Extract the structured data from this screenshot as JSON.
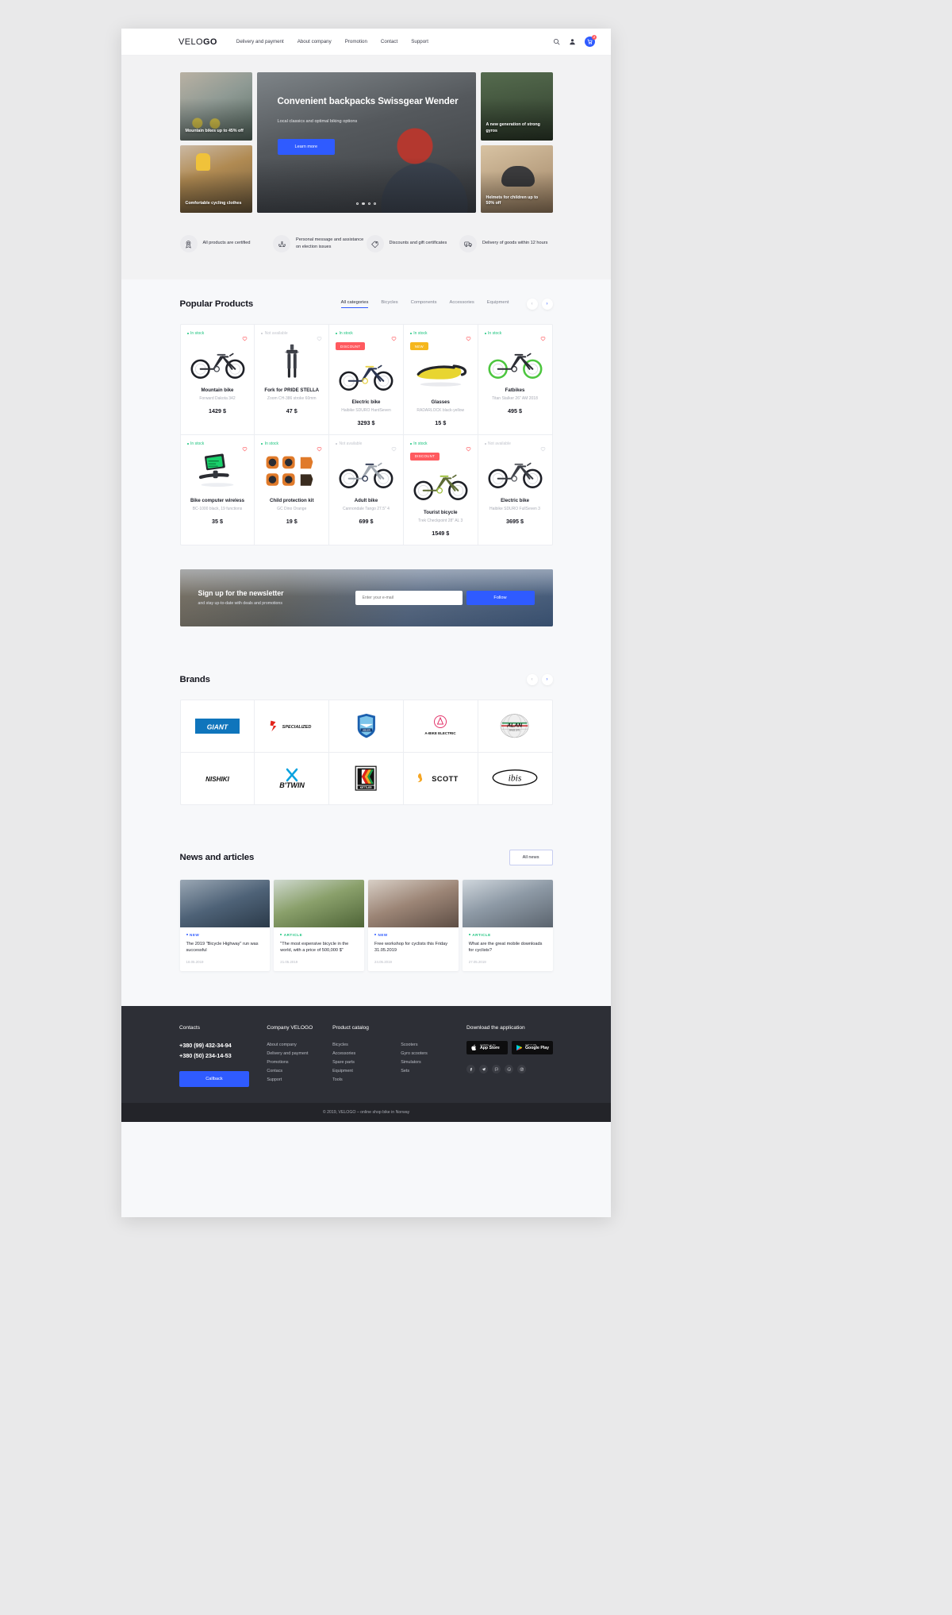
{
  "header": {
    "logo_prefix": "VELO",
    "logo_suffix": "GO",
    "nav": [
      {
        "label": "Delivery and payment"
      },
      {
        "label": "About company"
      },
      {
        "label": "Promotion"
      },
      {
        "label": "Contact"
      },
      {
        "label": "Support"
      }
    ],
    "cart_count": "2"
  },
  "hero": {
    "tiles": [
      {
        "caption": "Mountain bikes up to 45% off"
      },
      {
        "caption": "Comfortable cycling clothes"
      },
      {
        "caption": "A new generation of strong gyros"
      },
      {
        "caption": "Helmets for children up to 50% off"
      }
    ],
    "title": "Convenient backpacks Swissgear Wender",
    "subtitle": "Local classics and optimal biking options",
    "cta": "Learn more",
    "slide_count": 4,
    "active_slide": 2
  },
  "features": [
    {
      "icon": "award-icon",
      "text": "All products are certified"
    },
    {
      "icon": "hands-heart-icon",
      "text": "Personal message and assistance on election issues"
    },
    {
      "icon": "price-tag-icon",
      "text": "Discounts and gift certificates"
    },
    {
      "icon": "delivery-truck-icon",
      "text": "Delivery of goods within 12 hours"
    }
  ],
  "popular": {
    "title": "Popular Products",
    "tabs": [
      {
        "label": "All categories",
        "active": true
      },
      {
        "label": "Bicycles",
        "active": false
      },
      {
        "label": "Components",
        "active": false
      },
      {
        "label": "Accessories",
        "active": false
      },
      {
        "label": "Equipment",
        "active": false
      }
    ],
    "products": [
      {
        "stock": "In stock",
        "available": true,
        "tag": "",
        "name": "Mountain bike",
        "desc": "Forward Dakota 342",
        "price": "1429 $",
        "fav": true,
        "img": "mtb-dark"
      },
      {
        "stock": "Not available",
        "available": false,
        "tag": "",
        "name": "Fork for PRIDE STELLA",
        "desc": "Zoom CH-386 stroke 60mm",
        "price": "47 $",
        "fav": false,
        "img": "fork"
      },
      {
        "stock": "In stock",
        "available": true,
        "tag": "DISCOUNT",
        "name": "Electric bike",
        "desc": "Haibike SDURO HardSeven",
        "price": "3293 $",
        "fav": true,
        "img": "ebike-blue"
      },
      {
        "stock": "In stock",
        "available": true,
        "tag": "NEW",
        "name": "Glasses",
        "desc": "RADARLOCK black-yellow",
        "price": "15 $",
        "fav": true,
        "img": "glasses"
      },
      {
        "stock": "In stock",
        "available": true,
        "tag": "",
        "name": "Fatbikes",
        "desc": "Titan Stalker 26\" AM 2018",
        "price": "495 $",
        "fav": true,
        "img": "fatbike-green"
      },
      {
        "stock": "In stock",
        "available": true,
        "tag": "",
        "name": "Bike computer wireless",
        "desc": "BC-1000 black, 19 functions",
        "price": "35 $",
        "fav": true,
        "img": "computer"
      },
      {
        "stock": "In stock",
        "available": true,
        "tag": "",
        "name": "Child protection kit",
        "desc": "GC Dino Orange",
        "price": "19 $",
        "fav": true,
        "img": "protection"
      },
      {
        "stock": "Not available",
        "available": false,
        "tag": "",
        "name": "Adult bike",
        "desc": "Cannondale Tango 27.5\" 4",
        "price": "699 $",
        "fav": false,
        "img": "adult-bike"
      },
      {
        "stock": "In stock",
        "available": true,
        "tag": "DISCOUNT",
        "name": "Tourist bicycle",
        "desc": "Trek Checkpoint 28\" AL 3",
        "price": "1549 $",
        "fav": true,
        "img": "tourist"
      },
      {
        "stock": "Not available",
        "available": false,
        "tag": "",
        "name": "Electric bike",
        "desc": "Haibike SDURO FullSeven 3",
        "price": "3695 $",
        "fav": false,
        "img": "ebike-full"
      }
    ]
  },
  "newsletter": {
    "title": "Sign up for the newsletter",
    "subtitle": "and stay up-to-date with deals and promotions",
    "placeholder": "Enter your e-mail",
    "button": "Follow"
  },
  "brands": {
    "title": "Brands",
    "items": [
      {
        "name": "GIANT"
      },
      {
        "name": "SPECIALIZED"
      },
      {
        "name": "ADLER"
      },
      {
        "name": "A-BIKE ELECTRIC"
      },
      {
        "name": "ALAN"
      },
      {
        "name": "NISHIKI"
      },
      {
        "name": "B'TWIN"
      },
      {
        "name": "KETTLER"
      },
      {
        "name": "SCOTT"
      },
      {
        "name": "ibis"
      }
    ]
  },
  "news": {
    "title": "News and articles",
    "all_button": "All news",
    "items": [
      {
        "label": "NEW",
        "type": "new",
        "title": "The 2019 \"Bicycle Highway\" run was successful",
        "date": "18.05.2019"
      },
      {
        "label": "ARTICLE",
        "type": "article",
        "title": "\"The most expensive bicycle in the world, with a price of 500,000 $\"",
        "date": "21.05.2019"
      },
      {
        "label": "NEW",
        "type": "new",
        "title": "Free workshop for cyclists this Friday 31.05.2019",
        "date": "24.05.2019"
      },
      {
        "label": "ARTICLE",
        "type": "article",
        "title": "What are the great mobile downloads for cyclists?",
        "date": "27.05.2019"
      }
    ]
  },
  "footer": {
    "contacts_title": "Contacts",
    "phone1": "+380 (99) 432-34-94",
    "phone2": "+380 (50) 234-14-53",
    "callback": "Callback",
    "company_title": "Company VELOGO",
    "company_links": [
      "About company",
      "Delivery and payment",
      "Promotions",
      "Contacs",
      "Support"
    ],
    "catalog_title": "Product catalog",
    "catalog_links_1": [
      "Bicycles",
      "Accessories",
      "Spare parts",
      "Equipment",
      "Tools"
    ],
    "catalog_links_2": [
      "Scooters",
      "Gyro scooters",
      "Simulators",
      "Sets"
    ],
    "app_title": "Download the application",
    "appstore_small": "Available on the",
    "appstore_big": "App Store",
    "googleplay_small": "GET IT ON",
    "googleplay_big": "Google Play",
    "socials": [
      "facebook-icon",
      "telegram-icon",
      "viber-icon",
      "whatsapp-icon",
      "instagram-icon"
    ],
    "copyright": "© 2019, VELOGO – online shop bike in Norway"
  }
}
